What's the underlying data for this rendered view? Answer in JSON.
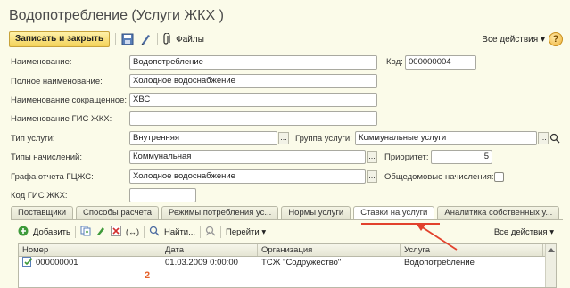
{
  "title": "Водопотребление (Услуги ЖКХ )",
  "toolbar": {
    "save_close": "Записать и закрыть",
    "files": "Файлы",
    "all_actions": "Все действия"
  },
  "form": {
    "name_label": "Наименование:",
    "name_value": "Водопотребление",
    "code_label": "Код:",
    "code_value": "000000004",
    "fullname_label": "Полное наименование:",
    "fullname_value": "Холодное водоснабжение",
    "shortname_label": "Наименование сокращенное:",
    "shortname_value": "ХВС",
    "gis_name_label": "Наименование ГИС ЖКХ:",
    "gis_name_value": "",
    "service_type_label": "Тип услуги:",
    "service_type_value": "Внутренняя",
    "group_label": "Группа услуги:",
    "group_value": "Коммунальные услуги",
    "accrual_types_label": "Типы начислений:",
    "accrual_types_value": "Коммунальная",
    "priority_label": "Приоритет:",
    "priority_value": "5",
    "report_column_label": "Графа отчета ГЦЖС:",
    "report_column_value": "Холодное водоснабжение",
    "common_house_label": "Общедомовые начисления:",
    "gis_code_label": "Код ГИС ЖКХ:",
    "gis_code_value": ""
  },
  "tabs": [
    "Поставщики",
    "Способы расчета",
    "Режимы потребления ус...",
    "Нормы услуги",
    "Ставки на услуги",
    "Аналитика собственных у..."
  ],
  "active_tab": 4,
  "subtoolbar": {
    "add": "Добавить",
    "find": "Найти...",
    "goto": "Перейти",
    "all_actions": "Все действия"
  },
  "table": {
    "columns": [
      "Номер",
      "Дата",
      "Организация",
      "Услуга"
    ],
    "rows": [
      {
        "number": "000000001",
        "date": "01.03.2009 0:00:00",
        "org": "ТСЖ \"Содружество\"",
        "service": "Водопотребление"
      }
    ]
  },
  "annotation_number": "2",
  "colors": {
    "accent": "#e2412c",
    "background": "#fbfbe9",
    "button": "#f3d25a"
  }
}
